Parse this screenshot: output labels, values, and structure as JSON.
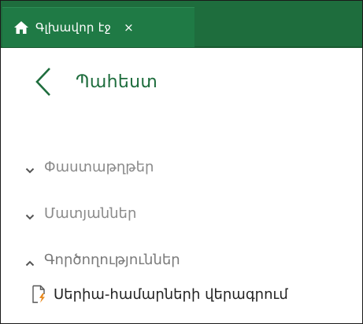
{
  "tab": {
    "label": "Գլխավոր էջ",
    "close": "×",
    "home_icon": "home-icon",
    "close_icon": "close-icon"
  },
  "back": {
    "label": "Պահեստ",
    "icon": "chevron-left-icon"
  },
  "sections": [
    {
      "label": "Փաստաթղթեր",
      "state": "collapsed",
      "icon": "chevron-down-icon"
    },
    {
      "label": "Մատյաններ",
      "state": "collapsed",
      "icon": "chevron-down-icon"
    },
    {
      "label": "Գործողություններ",
      "state": "expanded",
      "icon": "chevron-up-icon"
    }
  ],
  "actions": [
    {
      "label": "Սերիա-համարների վերագրում",
      "icon": "document-edit-icon"
    }
  ],
  "colors": {
    "tabbar": "#1e6d3d",
    "accent_text": "#1e6d3d",
    "muted_text": "#8a8a8a",
    "icon_orange": "#e8891e"
  }
}
